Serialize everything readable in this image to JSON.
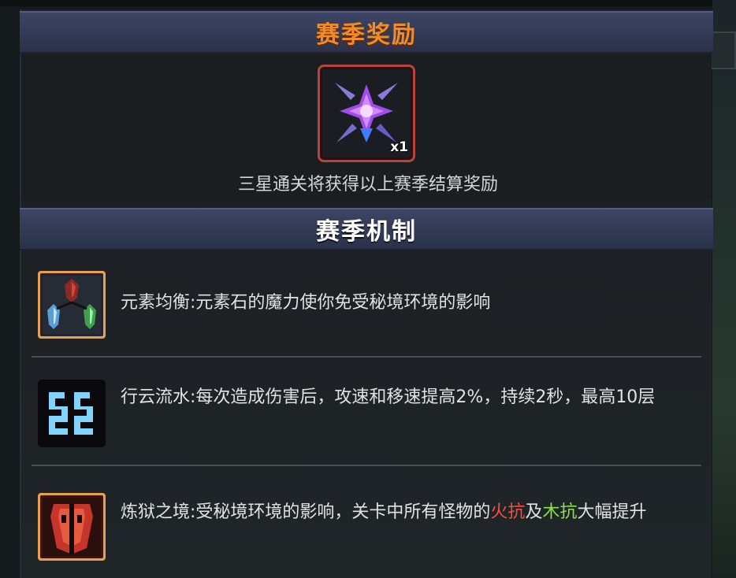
{
  "reward_section": {
    "title": "赛季奖励",
    "item": {
      "icon": "purple-star-blade-icon",
      "quantity": "x1"
    },
    "description": "三星通关将获得以上赛季结算奖励"
  },
  "mechanics_section": {
    "title": "赛季机制",
    "items": [
      {
        "icon": "element-stones-icon",
        "text": "元素均衡:元素石的魔力使你免受秘境环境的影响"
      },
      {
        "icon": "cloud-swirl-icon",
        "text": "行云流水:每次造成伤害后，攻速和移速提高2%，持续2秒，最高10层"
      },
      {
        "icon": "fire-wood-shield-icon",
        "text_before": "炼狱之境:受秘境环境的影响，关卡中所有怪物的",
        "hl_fire": "火抗",
        "text_mid": "及",
        "hl_wood": "木抗",
        "text_after": "大幅提升"
      }
    ]
  },
  "colors": {
    "reward_title": "#f08a2a",
    "fire": "#ff4b3e",
    "wood": "#8fe04a",
    "header_bar": "#323a55"
  }
}
